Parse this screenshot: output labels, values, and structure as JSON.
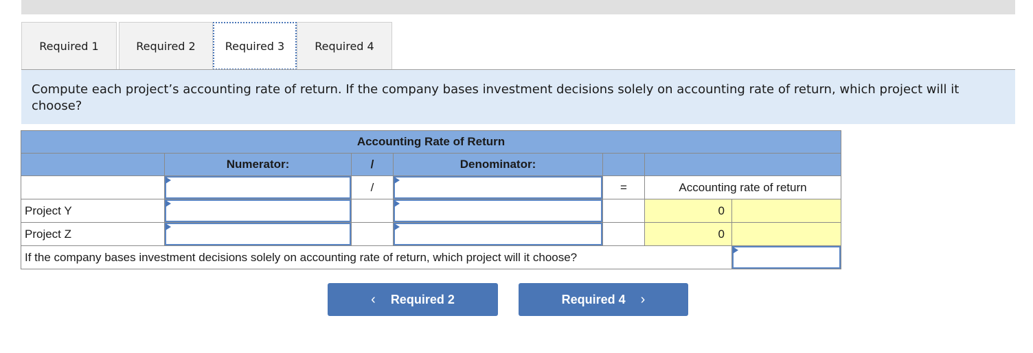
{
  "tabs": [
    {
      "label": "Required 1",
      "active": false
    },
    {
      "label": "Required 2",
      "active": false
    },
    {
      "label": "Required 3",
      "active": true
    },
    {
      "label": "Required 4",
      "active": false
    }
  ],
  "instruction": "Compute each project’s accounting rate of return. If the company bases investment decisions solely on accounting rate of return, which project will it choose?",
  "table": {
    "title": "Accounting Rate of Return",
    "headers": {
      "numerator": "Numerator:",
      "slash": "/",
      "denominator": "Denominator:"
    },
    "formula_row": {
      "slash": "/",
      "equals": "=",
      "result_label": "Accounting rate of return",
      "numerator_value": "",
      "denominator_value": ""
    },
    "rows": [
      {
        "label": "Project Y",
        "numerator_value": "",
        "denominator_value": "",
        "result": "0"
      },
      {
        "label": "Project Z",
        "numerator_value": "",
        "denominator_value": "",
        "result": "0"
      }
    ],
    "question": "If the company bases investment decisions solely on accounting rate of return, which project will it choose?",
    "answer_value": ""
  },
  "nav": {
    "prev_label": "Required 2",
    "next_label": "Required 4",
    "prev_icon": "‹",
    "next_icon": "›"
  },
  "colors": {
    "header_blue": "#82aadf",
    "instruction_bg": "#deeaf7",
    "result_yellow": "#ffffb3",
    "button_blue": "#4a76b6"
  }
}
